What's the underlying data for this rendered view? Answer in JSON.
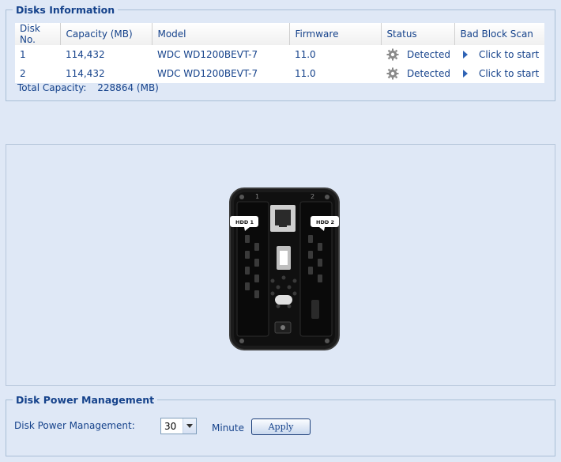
{
  "disks_info": {
    "legend": "Disks Information",
    "columns": [
      "Disk No.",
      "Capacity (MB)",
      "Model",
      "Firmware",
      "Status",
      "Bad Block Scan"
    ],
    "rows": [
      {
        "no": "1",
        "capacity": "114,432",
        "model": "WDC WD1200BEVT-7",
        "firmware": "11.0",
        "status": "Detected",
        "scan": "Click to start"
      },
      {
        "no": "2",
        "capacity": "114,432",
        "model": "WDC WD1200BEVT-7",
        "firmware": "11.0",
        "status": "Detected",
        "scan": "Click to start"
      }
    ],
    "total_label": "Total Capacity:",
    "total_value": "228864 (MB)"
  },
  "device": {
    "hdd1_label": "HDD 1",
    "hdd2_label": "HDD 2",
    "slot1_num": "1",
    "slot2_num": "2"
  },
  "power": {
    "legend": "Disk Power Management",
    "label": "Disk Power Management:",
    "selected": "30",
    "unit": "Minute",
    "apply": "Apply"
  },
  "colors": {
    "background": "#dfe8f6",
    "text": "#15428b",
    "border": "#a9bfd6"
  }
}
